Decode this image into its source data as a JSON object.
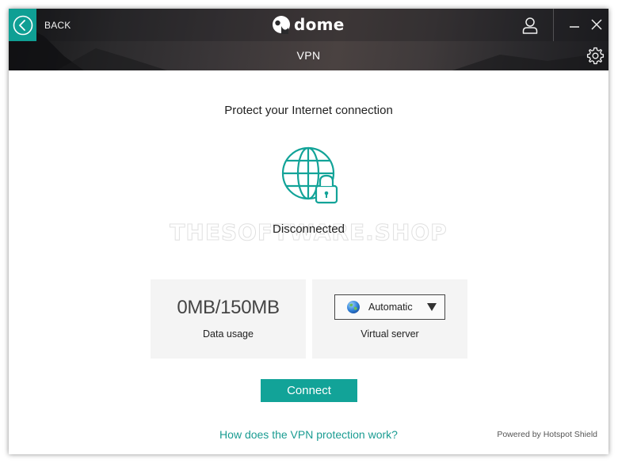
{
  "colors": {
    "accent": "#12a398",
    "back_button": "#0f9f94",
    "link": "#1a9c92",
    "card_bg": "#f4f4f4"
  },
  "titlebar": {
    "back_label": "BACK",
    "logo_text": "dome",
    "logo_icon": "panda-logo-icon",
    "icons": [
      "chevron-left-icon",
      "user-icon",
      "minimize-icon",
      "close-icon"
    ]
  },
  "subheader": {
    "title": "VPN",
    "settings_icon": "gear-icon"
  },
  "main": {
    "headline": "Protect your Internet connection",
    "status_icon": "globe-lock-icon",
    "status": "Disconnected",
    "watermark": "THESOFTWARE.SHOP"
  },
  "data_usage": {
    "value": "0MB/150MB",
    "label": "Data usage"
  },
  "virtual_server": {
    "selected": "Automatic",
    "label": "Virtual server",
    "icon": "globe-icon"
  },
  "actions": {
    "connect_label": "Connect",
    "help_link": "How does the VPN protection work?"
  },
  "footer": {
    "powered_by": "Powered by Hotspot Shield"
  }
}
